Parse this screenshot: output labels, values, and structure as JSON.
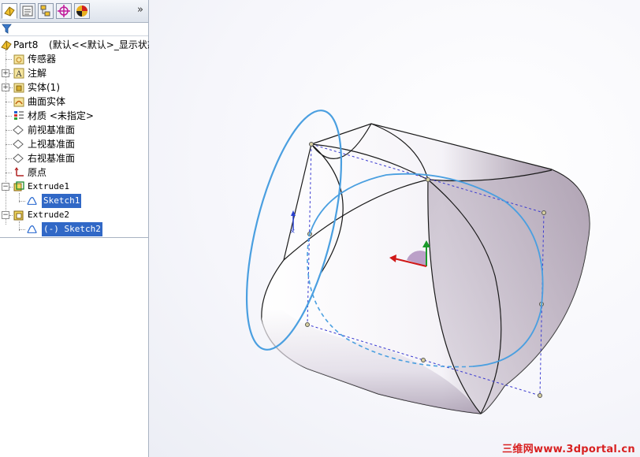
{
  "feature_tree": {
    "part_label": "Part8",
    "part_config": "(默认<<默认>_显示状态",
    "items": [
      {
        "label": "传感器"
      },
      {
        "label": "注解"
      },
      {
        "label": "实体(1)"
      },
      {
        "label": "曲面实体"
      },
      {
        "label": "材质 <未指定>"
      },
      {
        "label": "前视基准面"
      },
      {
        "label": "上视基准面"
      },
      {
        "label": "右视基准面"
      },
      {
        "label": "原点"
      },
      {
        "label": "Extrude1"
      },
      {
        "label": "Sketch1"
      },
      {
        "label": "Extrude2"
      },
      {
        "label": "(-) Sketch2"
      }
    ]
  },
  "panel": {
    "collapse_glyph": "»",
    "tab_icons": [
      "feature-manager-icon",
      "property-manager-icon",
      "configuration-manager-icon",
      "dimxpert-icon",
      "display-manager-icon"
    ]
  },
  "watermark": "三维网www.3dportal.cn",
  "colors": {
    "selection": "#3168c6",
    "sketch_blue": "#4a9fe0",
    "construction_dash": "#3b3bd0",
    "triad_x": "#d01818",
    "triad_y": "#1a9a2a"
  }
}
